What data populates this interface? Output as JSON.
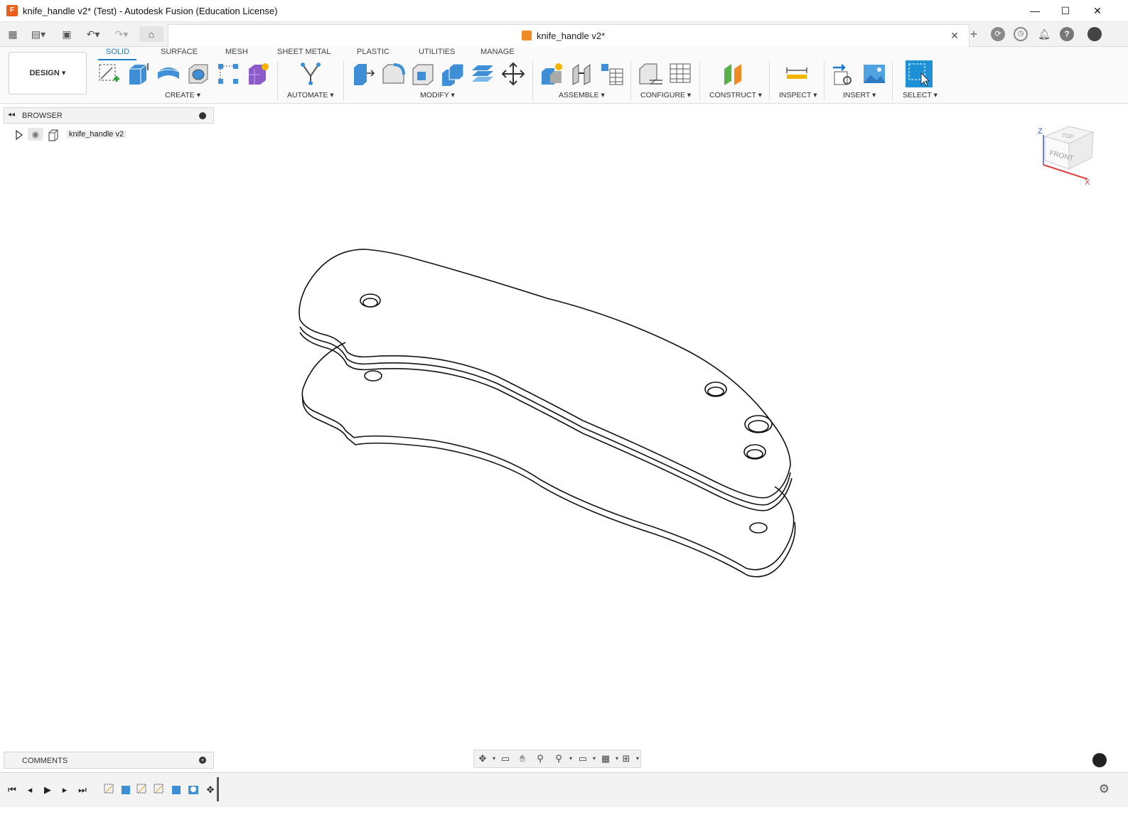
{
  "window": {
    "title": "knife_handle v2* (Test) - Autodesk Fusion (Education License)",
    "app_icon_letter": "F",
    "controls": [
      "minimize",
      "maximize",
      "close"
    ]
  },
  "quick_access": {
    "icons": [
      "grid-icon",
      "file-icon",
      "save-icon",
      "undo-icon",
      "redo-icon",
      "home-icon"
    ]
  },
  "document_tab": {
    "label": "knife_handle v2*",
    "close": "✕"
  },
  "right_icons": [
    "new-tab-icon",
    "job-status-icon",
    "history-icon",
    "notifications-icon",
    "help-icon",
    "profile-avatar"
  ],
  "workspace": {
    "label": "DESIGN ▾"
  },
  "ribbon_tabs": [
    "SOLID",
    "SURFACE",
    "MESH",
    "SHEET METAL",
    "PLASTIC",
    "UTILITIES",
    "MANAGE"
  ],
  "ribbon_groups": {
    "create": "CREATE ▾",
    "automate": "AUTOMATE ▾",
    "modify": "MODIFY ▾",
    "assemble": "ASSEMBLE ▾",
    "configure": "CONFIGURE ▾",
    "construct": "CONSTRUCT ▾",
    "inspect": "INSPECT ▾",
    "insert": "INSERT ▾",
    "select": "SELECT ▾"
  },
  "browser": {
    "title": "BROWSER",
    "root_node": "knife_handle v2"
  },
  "comments": {
    "title": "COMMENTS"
  },
  "viewcube": {
    "top": "TOP",
    "front": "FRONT",
    "axis_z": "Z",
    "axis_x": "X"
  },
  "colors": {
    "accent": "#1c78c8",
    "select_button": "#1e90d6",
    "app_icon": "#e8601c"
  }
}
